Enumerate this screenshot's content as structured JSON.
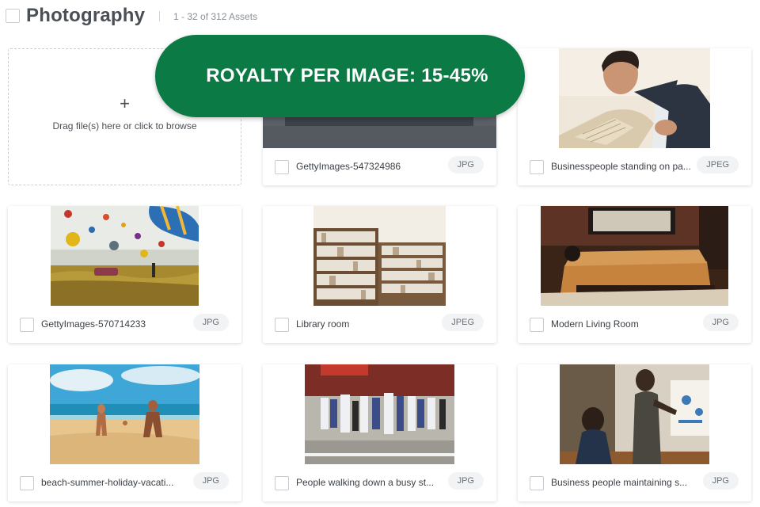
{
  "header": {
    "title": "Photography",
    "count": "1 - 32 of 312 Assets"
  },
  "upload": {
    "plus": "+",
    "hint": "Drag file(s) here or click to browse"
  },
  "banner": {
    "text": "ROYALTY PER IMAGE: 15-45%",
    "color": "#0b7a45"
  },
  "assets": [
    {
      "name": "GettyImages-547324986",
      "type": "JPG"
    },
    {
      "name": "Businesspeople standing on pa...",
      "type": "JPEG"
    },
    {
      "name": "GettyImages-570714233",
      "type": "JPG"
    },
    {
      "name": "Library room",
      "type": "JPEG"
    },
    {
      "name": "Modern Living Room",
      "type": "JPG"
    },
    {
      "name": "beach-summer-holiday-vacati...",
      "type": "JPG"
    },
    {
      "name": "People walking down a busy st...",
      "type": "JPG"
    },
    {
      "name": "Business people maintaining s...",
      "type": "JPG"
    }
  ]
}
